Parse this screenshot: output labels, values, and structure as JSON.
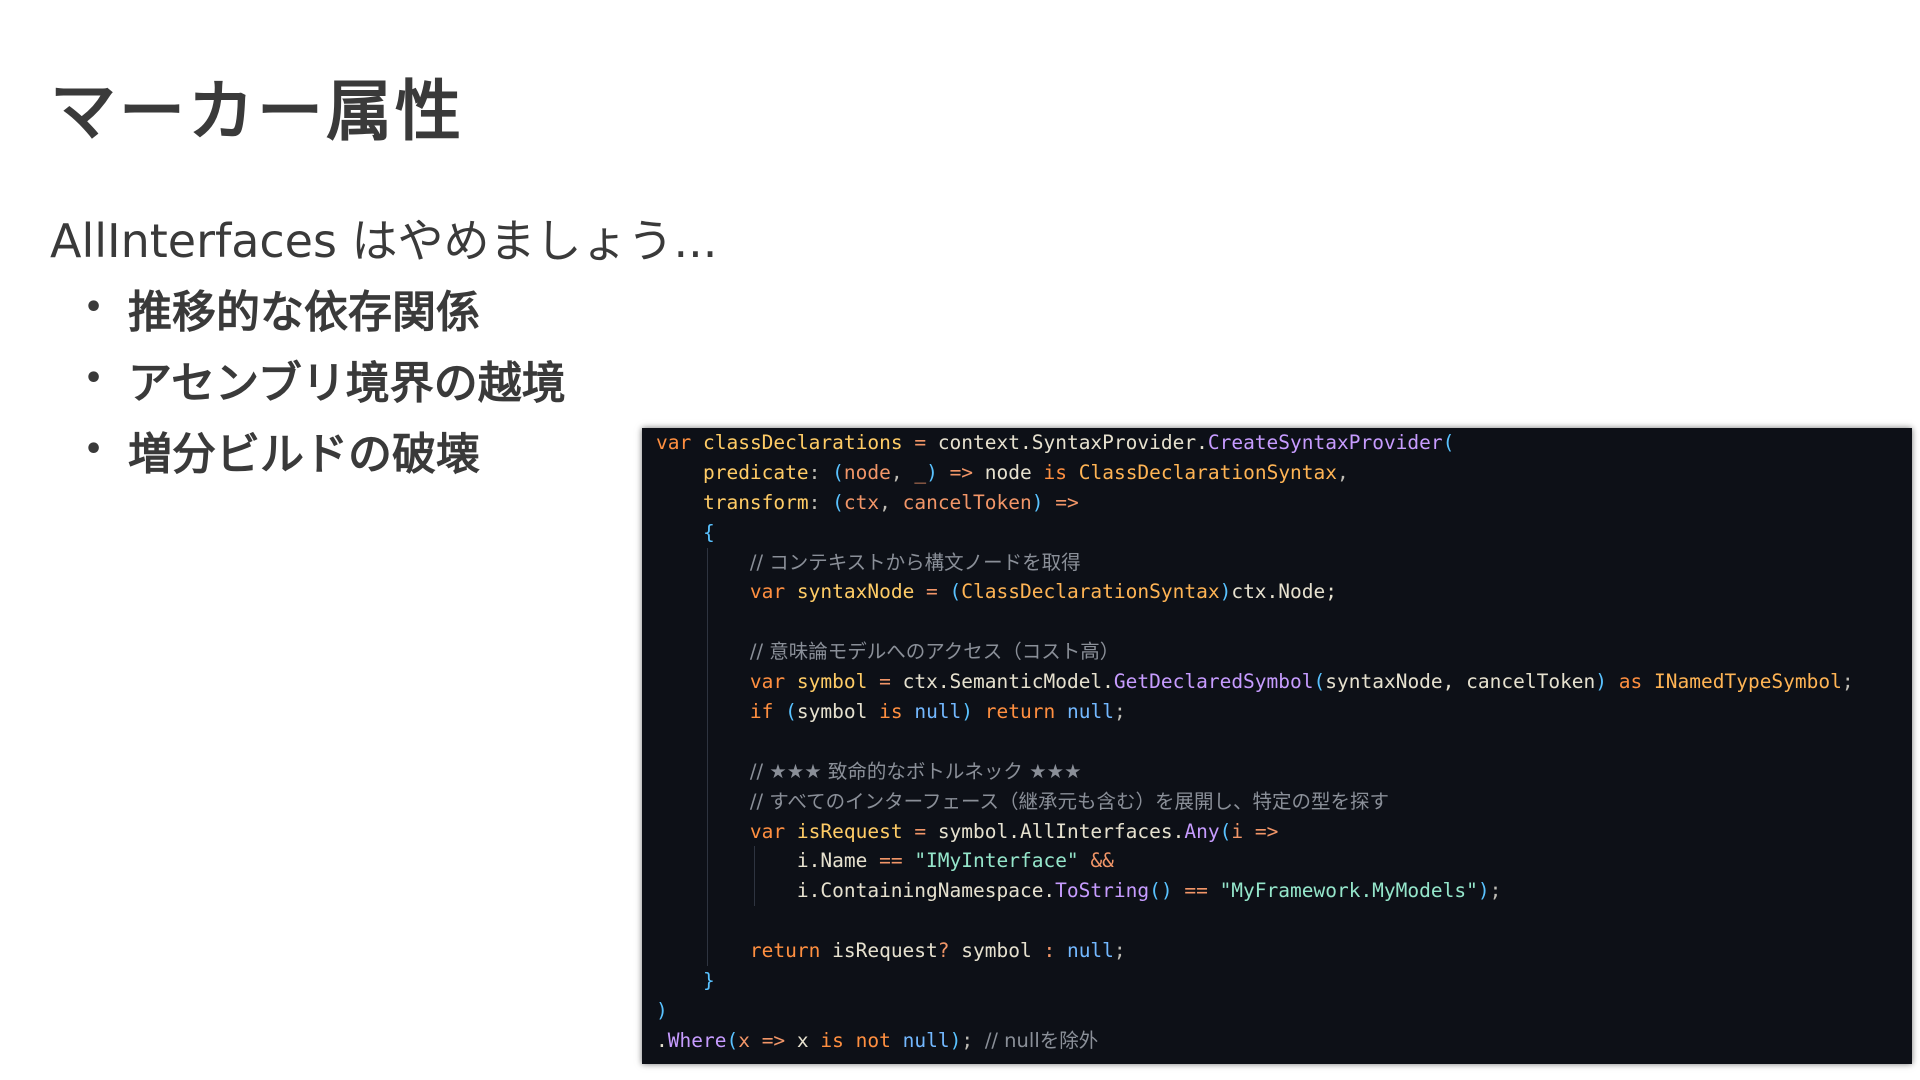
{
  "slide": {
    "title": "マーカー属性",
    "subtitle": "AllInterfaces はやめましょう...",
    "bullet_symbol": "•",
    "bullets": [
      "推移的な依存関係",
      "アセンブリ境界の越境",
      "増分ビルドの破壊"
    ]
  },
  "code": {
    "language": "csharp",
    "theme_background": "#0d1017",
    "lines": [
      {
        "indent": 0,
        "tokens": [
          [
            "kw",
            "var"
          ],
          [
            "id",
            " "
          ],
          [
            "vr",
            "classDeclarations"
          ],
          [
            "op",
            " = "
          ],
          [
            "id",
            "context.SyntaxProvider."
          ],
          [
            "fn",
            "CreateSyntaxProvider"
          ],
          [
            "br",
            "("
          ]
        ]
      },
      {
        "indent": 1,
        "tokens": [
          [
            "vr",
            "predicate"
          ],
          [
            "pu",
            ": "
          ],
          [
            "br",
            "("
          ],
          [
            "pm",
            "node"
          ],
          [
            "pu",
            ", "
          ],
          [
            "pm",
            "_"
          ],
          [
            "br",
            ")"
          ],
          [
            "op",
            " => "
          ],
          [
            "id",
            "node "
          ],
          [
            "kw",
            "is"
          ],
          [
            "id",
            " "
          ],
          [
            "ty",
            "ClassDeclarationSyntax"
          ],
          [
            "pu",
            ","
          ]
        ]
      },
      {
        "indent": 1,
        "tokens": [
          [
            "vr",
            "transform"
          ],
          [
            "pu",
            ": "
          ],
          [
            "br",
            "("
          ],
          [
            "pm",
            "ctx"
          ],
          [
            "pu",
            ", "
          ],
          [
            "pm",
            "cancelToken"
          ],
          [
            "br",
            ")"
          ],
          [
            "op",
            " =>"
          ]
        ]
      },
      {
        "indent": 1,
        "tokens": [
          [
            "br",
            "{"
          ]
        ]
      },
      {
        "indent": 2,
        "tokens": [
          [
            "cm",
            "// コンテキストから構文ノードを取得"
          ]
        ]
      },
      {
        "indent": 2,
        "tokens": [
          [
            "kw",
            "var"
          ],
          [
            "id",
            " "
          ],
          [
            "vr",
            "syntaxNode"
          ],
          [
            "op",
            " = "
          ],
          [
            "br",
            "("
          ],
          [
            "ty",
            "ClassDeclarationSyntax"
          ],
          [
            "br",
            ")"
          ],
          [
            "id",
            "ctx.Node;"
          ]
        ]
      },
      {
        "indent": 2,
        "tokens": []
      },
      {
        "indent": 2,
        "tokens": [
          [
            "cm",
            "// 意味論モデルへのアクセス（コスト高）"
          ]
        ]
      },
      {
        "indent": 2,
        "tokens": [
          [
            "kw",
            "var"
          ],
          [
            "id",
            " "
          ],
          [
            "vr",
            "symbol"
          ],
          [
            "op",
            " = "
          ],
          [
            "id",
            "ctx.SemanticModel."
          ],
          [
            "fn",
            "GetDeclaredSymbol"
          ],
          [
            "br",
            "("
          ],
          [
            "id",
            "syntaxNode, cancelToken"
          ],
          [
            "br",
            ")"
          ],
          [
            "id",
            " "
          ],
          [
            "kw",
            "as"
          ],
          [
            "id",
            " "
          ],
          [
            "ty",
            "INamedTypeSymbol"
          ],
          [
            "pu",
            ";"
          ]
        ]
      },
      {
        "indent": 2,
        "tokens": [
          [
            "kw",
            "if"
          ],
          [
            "id",
            " "
          ],
          [
            "br",
            "("
          ],
          [
            "id",
            "symbol "
          ],
          [
            "kw",
            "is"
          ],
          [
            "id",
            " "
          ],
          [
            "nl",
            "null"
          ],
          [
            "br",
            ")"
          ],
          [
            "id",
            " "
          ],
          [
            "kw",
            "return"
          ],
          [
            "id",
            " "
          ],
          [
            "nl",
            "null"
          ],
          [
            "pu",
            ";"
          ]
        ]
      },
      {
        "indent": 2,
        "tokens": []
      },
      {
        "indent": 2,
        "tokens": [
          [
            "cm",
            "// ★★★ 致命的なボトルネック ★★★"
          ]
        ]
      },
      {
        "indent": 2,
        "tokens": [
          [
            "cm",
            "// すべてのインターフェース（継承元も含む）を展開し、特定の型を探す"
          ]
        ]
      },
      {
        "indent": 2,
        "tokens": [
          [
            "kw",
            "var"
          ],
          [
            "id",
            " "
          ],
          [
            "vr",
            "isRequest"
          ],
          [
            "op",
            " = "
          ],
          [
            "id",
            "symbol.AllInterfaces."
          ],
          [
            "fn",
            "Any"
          ],
          [
            "br",
            "("
          ],
          [
            "pm",
            "i"
          ],
          [
            "op",
            " =>"
          ]
        ]
      },
      {
        "indent": 3,
        "tokens": [
          [
            "id",
            "i.Name "
          ],
          [
            "op",
            "=="
          ],
          [
            "id",
            " "
          ],
          [
            "str2",
            "\"IMyInterface\""
          ],
          [
            "id",
            " "
          ],
          [
            "op",
            "&&"
          ]
        ]
      },
      {
        "indent": 3,
        "tokens": [
          [
            "id",
            "i.ContainingNamespace."
          ],
          [
            "fn",
            "ToString"
          ],
          [
            "br",
            "()"
          ],
          [
            "id",
            " "
          ],
          [
            "op",
            "=="
          ],
          [
            "id",
            " "
          ],
          [
            "str2",
            "\"MyFramework.MyModels\""
          ],
          [
            "br",
            ")"
          ],
          [
            "pu",
            ";"
          ]
        ]
      },
      {
        "indent": 2,
        "tokens": []
      },
      {
        "indent": 2,
        "tokens": [
          [
            "kw",
            "return"
          ],
          [
            "id",
            " isRequest"
          ],
          [
            "op",
            "?"
          ],
          [
            "id",
            " symbol "
          ],
          [
            "op",
            ":"
          ],
          [
            "id",
            " "
          ],
          [
            "nl",
            "null"
          ],
          [
            "pu",
            ";"
          ]
        ]
      },
      {
        "indent": 1,
        "tokens": [
          [
            "br",
            "}"
          ]
        ]
      },
      {
        "indent": 0,
        "tokens": [
          [
            "br",
            ")"
          ]
        ]
      },
      {
        "indent": 0,
        "tokens": [
          [
            "id",
            "."
          ],
          [
            "fn",
            "Where"
          ],
          [
            "br",
            "("
          ],
          [
            "pm",
            "x"
          ],
          [
            "op",
            " => "
          ],
          [
            "id",
            "x "
          ],
          [
            "kw",
            "is"
          ],
          [
            "id",
            " "
          ],
          [
            "kw",
            "not"
          ],
          [
            "id",
            " "
          ],
          [
            "nl",
            "null"
          ],
          [
            "br",
            ")"
          ],
          [
            "pu",
            ";"
          ],
          [
            "id",
            " "
          ],
          [
            "cm",
            "// nullを除外"
          ]
        ]
      }
    ]
  }
}
